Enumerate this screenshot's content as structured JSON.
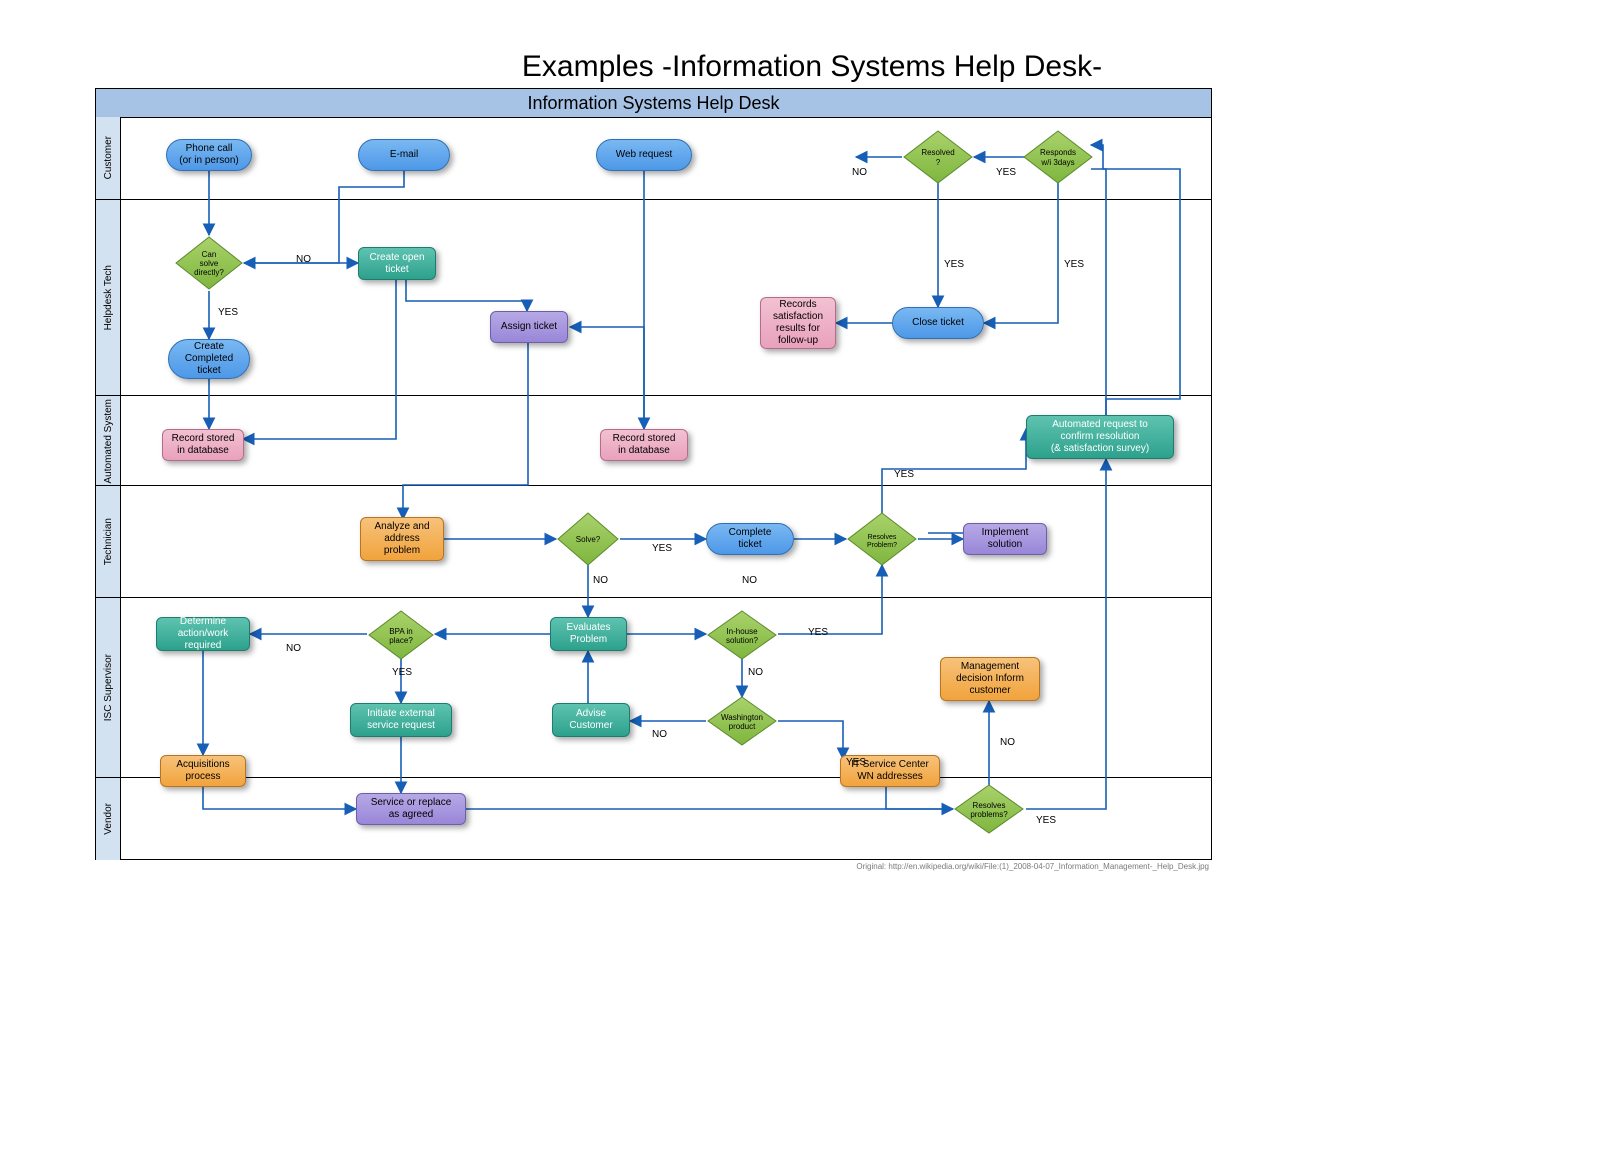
{
  "title": "Examples -Information Systems Help Desk-",
  "frameTitle": "Information Systems Help Desk",
  "lanes": {
    "customer": "Customer",
    "helpdesk": "Helpdesk Tech",
    "automated": "Automated System",
    "technician": "Technician",
    "isc": "ISC Supervisor",
    "vendor": "Vendor"
  },
  "nodes": {
    "phoneCall": "Phone call\n(or in person)",
    "email": "E-mail",
    "webRequest": "Web request",
    "resolved": "Resolved\n?",
    "responds": "Responds\nw/i 3days",
    "canSolve": "Can\nsolve\ndirectly?",
    "createOpen": "Create open\nticket",
    "createCompleted": "Create\nCompleted\nticket",
    "assignTicket": "Assign ticket",
    "recordsSat": "Records\nsatisfaction\nresults for\nfollow-up",
    "closeTicket": "Close ticket",
    "recordStored1": "Record stored\nin database",
    "recordStored2": "Record stored\nin database",
    "automatedReq": "Automated request to\nconfirm resolution\n(& satisfaction survey)",
    "analyze": "Analyze and\naddress\nproblem",
    "solve": "Solve?",
    "completeTicket": "Complete\nticket",
    "resolvesProblem": "Resolves\nProblem?",
    "implement": "Implement\nsolution",
    "determine": "Determine\naction/work\nrequired",
    "bpa": "BPA in\nplace?",
    "evaluates": "Evaluates\nProblem",
    "inhouse": "In-house\nsolution?",
    "initiate": "Initiate external\nservice request",
    "advise": "Advise\nCustomer",
    "washington": "Washington\nproduct",
    "mgmtDecision": "Management\ndecision Inform\ncustomer",
    "itService": "IT Service Center\nWN addresses",
    "acquisitions": "Acquisitions\nprocess",
    "serviceReplace": "Service or replace\nas agreed",
    "resolvesProblems": "Resolves\nproblems?"
  },
  "edgeLabels": {
    "no": "NO",
    "yes": "YES"
  },
  "attribution": "Original: http://en.wikipedia.org/wiki/File:(1)_2008-04-07_Information_Management-_Help_Desk.jpg"
}
